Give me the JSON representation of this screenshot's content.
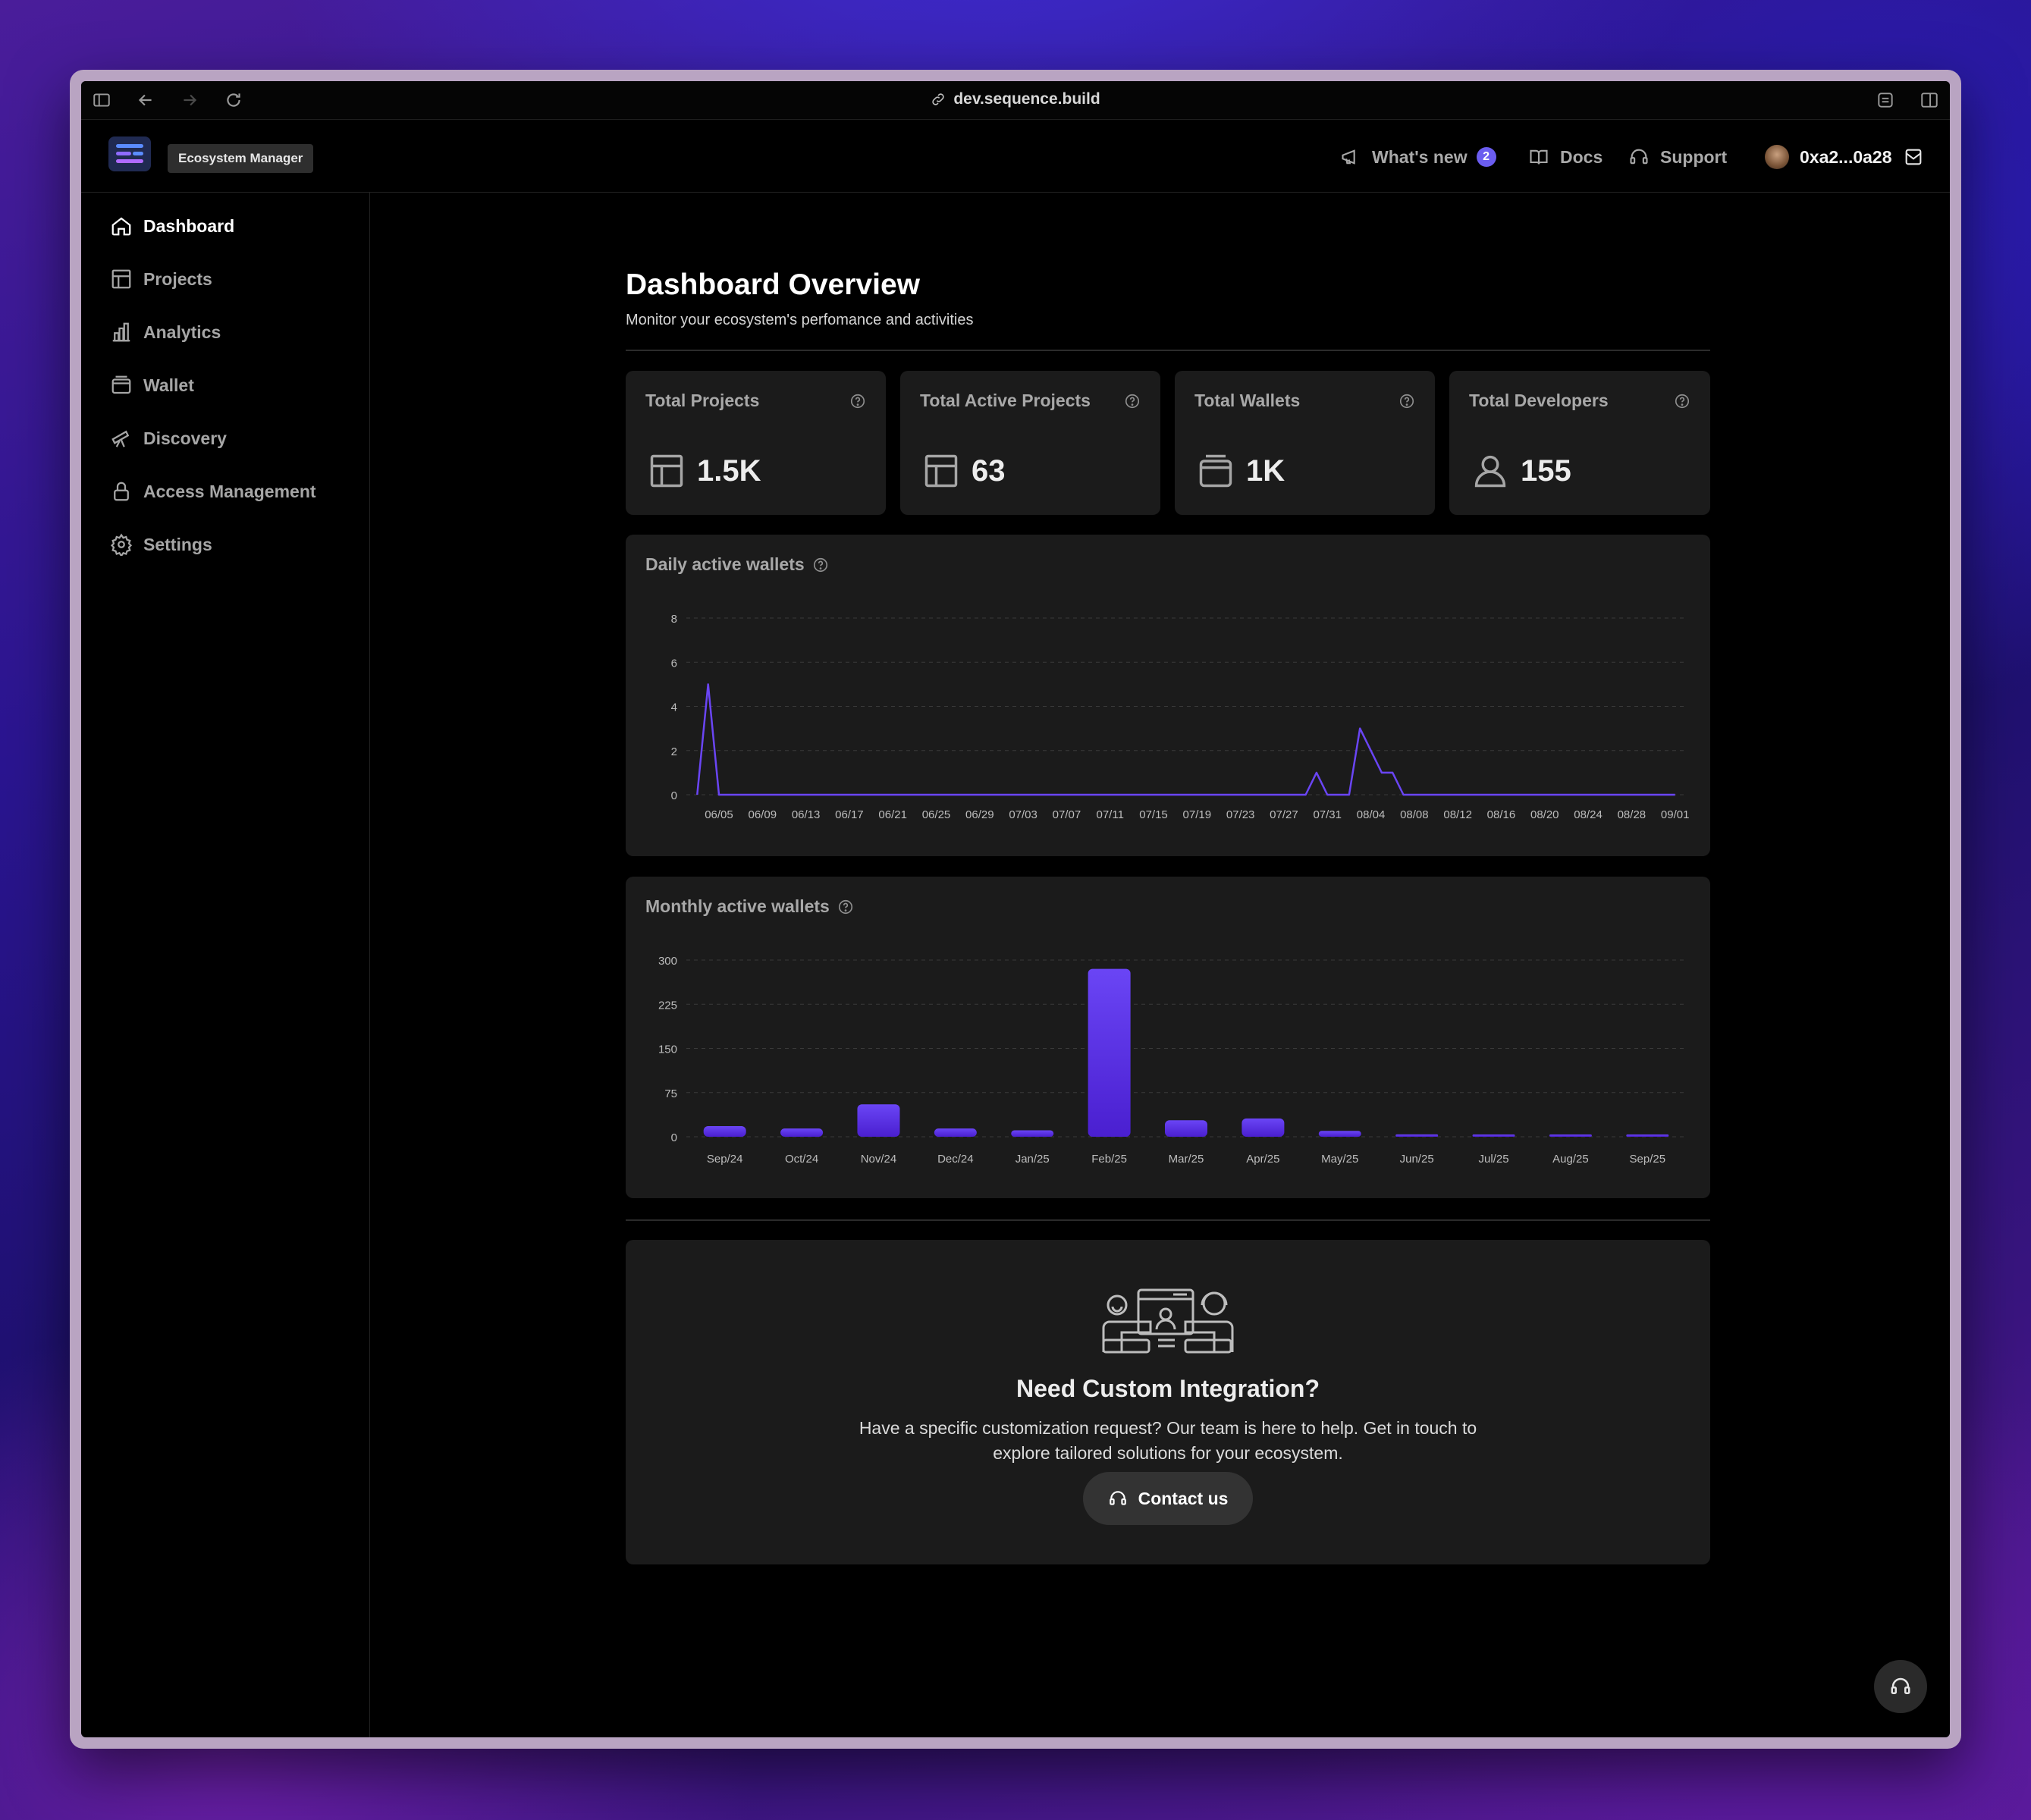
{
  "browser": {
    "url": "dev.sequence.build",
    "icons": [
      "sidebar-toggle-icon",
      "back-arrow-icon",
      "forward-arrow-icon",
      "reload-icon",
      "link-icon",
      "extension-icon",
      "split-view-icon"
    ]
  },
  "header": {
    "badge": "Ecosystem Manager",
    "whats_new": "What's new",
    "whats_new_count": "2",
    "docs": "Docs",
    "support": "Support",
    "user": "0xa2...0a28"
  },
  "sidebar": {
    "items": [
      {
        "label": "Dashboard",
        "icon": "home-icon",
        "active": true
      },
      {
        "label": "Projects",
        "icon": "table-icon"
      },
      {
        "label": "Analytics",
        "icon": "bar-chart-icon"
      },
      {
        "label": "Wallet",
        "icon": "wallet-icon"
      },
      {
        "label": "Discovery",
        "icon": "telescope-icon"
      },
      {
        "label": "Access Management",
        "icon": "lock-icon"
      },
      {
        "label": "Settings",
        "icon": "gear-icon"
      }
    ]
  },
  "page": {
    "title": "Dashboard Overview",
    "subtitle": "Monitor your ecosystem's perfomance and activities"
  },
  "stats": [
    {
      "label": "Total Projects",
      "value": "1.5K",
      "icon": "table-icon"
    },
    {
      "label": "Total Active Projects",
      "value": "63",
      "icon": "table-icon"
    },
    {
      "label": "Total Wallets",
      "value": "1K",
      "icon": "wallet-icon"
    },
    {
      "label": "Total Developers",
      "value": "155",
      "icon": "user-icon"
    }
  ],
  "colors": {
    "accent": "#6a45f5",
    "accent_dark": "#4a1fd0",
    "card": "#1b1b1b"
  },
  "chart_data": [
    {
      "type": "line",
      "title": "Daily active wallets",
      "ylim": [
        0,
        8
      ],
      "yticks": [
        0,
        2,
        4,
        6,
        8
      ],
      "xticks": [
        "06/05",
        "06/09",
        "06/13",
        "06/17",
        "06/21",
        "06/25",
        "06/29",
        "07/03",
        "07/07",
        "07/11",
        "07/15",
        "07/19",
        "07/23",
        "07/27",
        "07/31",
        "08/04",
        "08/08",
        "08/12",
        "08/16",
        "08/20",
        "08/24",
        "08/28",
        "09/01"
      ],
      "series": [
        {
          "values": [
            {
              "x": "06/03",
              "y": 0
            },
            {
              "x": "06/04",
              "y": 5
            },
            {
              "x": "06/05",
              "y": 0
            },
            {
              "x": "07/29",
              "y": 0
            },
            {
              "x": "07/30",
              "y": 1
            },
            {
              "x": "07/31",
              "y": 0
            },
            {
              "x": "08/02",
              "y": 0
            },
            {
              "x": "08/03",
              "y": 3
            },
            {
              "x": "08/05",
              "y": 1
            },
            {
              "x": "08/06",
              "y": 1
            },
            {
              "x": "08/07",
              "y": 0
            },
            {
              "x": "09/01",
              "y": 0
            }
          ]
        }
      ],
      "grid": true
    },
    {
      "type": "bar",
      "title": "Monthly active wallets",
      "ylim": [
        0,
        300
      ],
      "yticks": [
        0,
        75,
        150,
        225,
        300
      ],
      "categories": [
        "Sep/24",
        "Oct/24",
        "Nov/24",
        "Dec/24",
        "Jan/25",
        "Feb/25",
        "Mar/25",
        "Apr/25",
        "May/25",
        "Jun/25",
        "Jul/25",
        "Aug/25",
        "Sep/25"
      ],
      "values": [
        18,
        14,
        55,
        14,
        11,
        285,
        28,
        31,
        10,
        4,
        3,
        3,
        3
      ],
      "grid": true
    }
  ],
  "cta": {
    "title": "Need Custom Integration?",
    "text": "Have a specific customization request? Our team is here to help. Get in touch to explore tailored solutions for your ecosystem.",
    "button": "Contact us"
  }
}
